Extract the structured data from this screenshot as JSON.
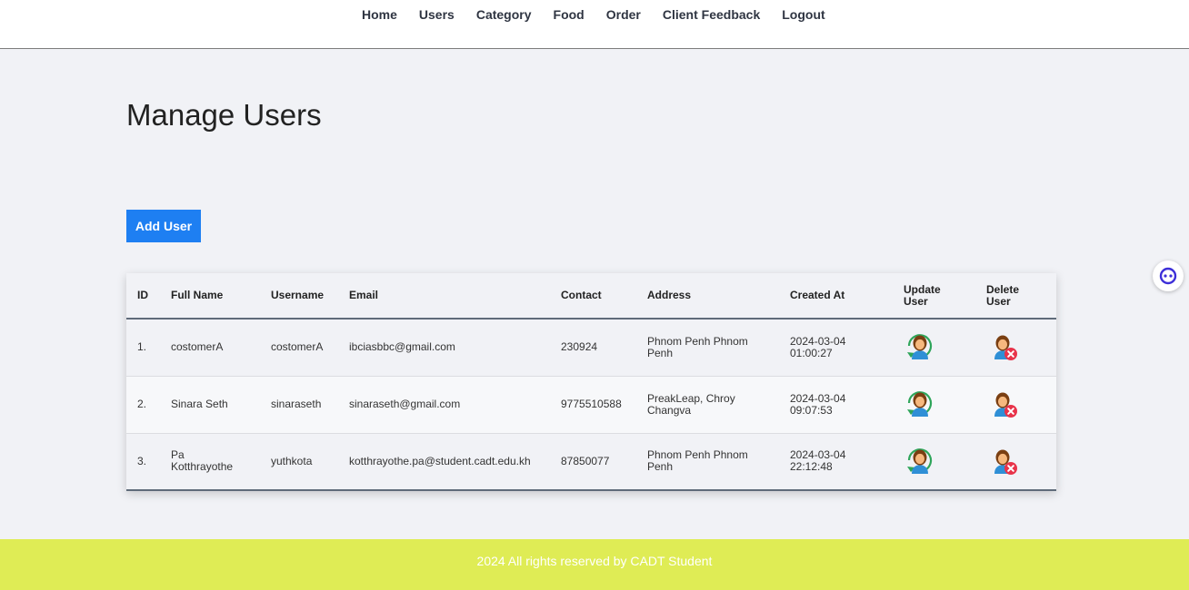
{
  "nav": {
    "items": [
      "Home",
      "Users",
      "Category",
      "Food",
      "Order",
      "Client Feedback",
      "Logout"
    ]
  },
  "page": {
    "title": "Manage Users",
    "add_button": "Add User"
  },
  "table": {
    "headers": {
      "id": "ID",
      "full_name": "Full Name",
      "username": "Username",
      "email": "Email",
      "contact": "Contact",
      "address": "Address",
      "created_at": "Created At",
      "update": "Update User",
      "delete": "Delete User"
    },
    "rows": [
      {
        "id": "1.",
        "full_name": "costomerA",
        "username": "costomerA",
        "email": "ibciasbbc@gmail.com",
        "contact": "230924",
        "address": "Phnom Penh Phnom Penh",
        "created_at": "2024-03-04 01:00:27"
      },
      {
        "id": "2.",
        "full_name": "Sinara Seth",
        "username": "sinaraseth",
        "email": "sinaraseth@gmail.com",
        "contact": "9775510588",
        "address": "PreakLeap, Chroy Changva",
        "created_at": "2024-03-04 09:07:53"
      },
      {
        "id": "3.",
        "full_name": "Pa Kotthrayothe",
        "username": "yuthkota",
        "email": "kotthrayothe.pa@student.cadt.edu.kh",
        "contact": "87850077",
        "address": "Phnom Penh Phnom Penh",
        "created_at": "2024-03-04 22:12:48"
      }
    ],
    "icons": {
      "update": "user-refresh-icon",
      "delete": "user-delete-icon"
    }
  },
  "footer": {
    "text": "2024 All rights reserved by CADT Student"
  },
  "colors": {
    "accent": "#1e7ff2",
    "footer": "#dfec55",
    "delete_badge": "#e8334a",
    "refresh_ring": "#2ea55a"
  }
}
